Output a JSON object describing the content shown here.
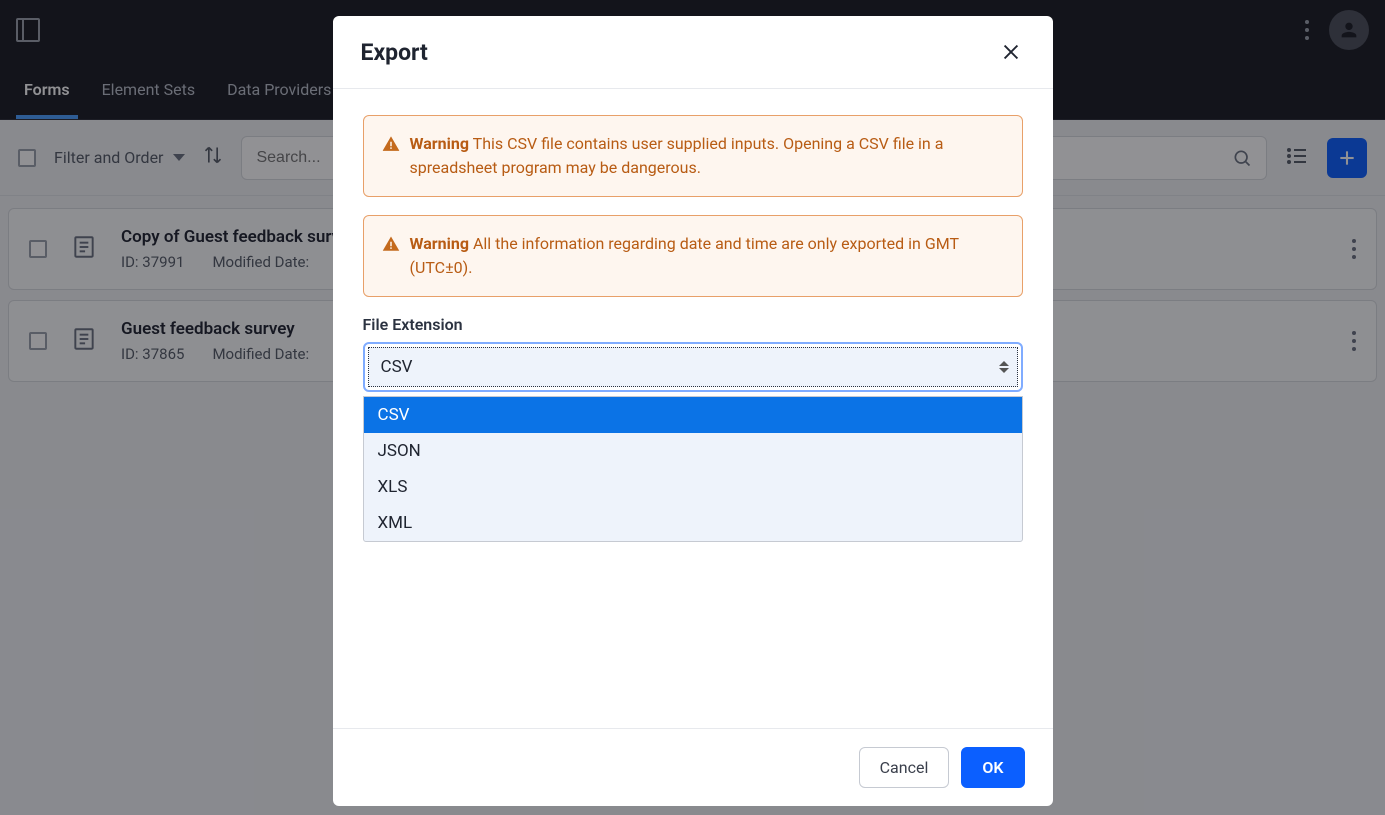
{
  "nav": {
    "tabs": [
      "Forms",
      "Element Sets",
      "Data Providers"
    ],
    "active_index": 0
  },
  "toolbar": {
    "filter_label": "Filter and Order",
    "search_placeholder": "Search..."
  },
  "rows": [
    {
      "title": "Copy of Guest feedback survey",
      "id_label": "ID: 37991",
      "modified_label": "Modified Date:"
    },
    {
      "title": "Guest feedback survey",
      "id_label": "ID: 37865",
      "modified_label": "Modified Date:"
    }
  ],
  "modal": {
    "title": "Export",
    "warning_label": "Warning",
    "warning1": "This CSV file contains user supplied inputs. Opening a CSV file in a spreadsheet program may be dangerous.",
    "warning2": "All the information regarding date and time are only exported in GMT (UTC±0).",
    "field_label": "File Extension",
    "selected": "CSV",
    "options": [
      "CSV",
      "JSON",
      "XLS",
      "XML"
    ],
    "cancel": "Cancel",
    "ok": "OK"
  }
}
